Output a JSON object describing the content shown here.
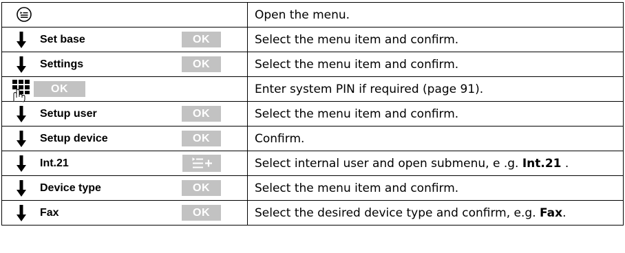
{
  "rows": [
    {
      "type": "menu",
      "icon": "menu-key-icon",
      "desc": "Open the menu."
    },
    {
      "type": "nav",
      "item": "Set base",
      "action": "OK",
      "desc": "Select the menu item and confirm."
    },
    {
      "type": "nav",
      "item": "Settings",
      "action": "OK",
      "desc": "Select the menu item and confirm."
    },
    {
      "type": "pin",
      "icon": "keypad-icon",
      "action": "OK",
      "desc_pre": "Enter system PIN if required (page 91)."
    },
    {
      "type": "nav",
      "item": "Setup user",
      "action": "OK",
      "desc": "Select the menu item and confirm."
    },
    {
      "type": "nav",
      "item": "Setup device",
      "action": "OK",
      "desc": "Confirm."
    },
    {
      "type": "submenu",
      "item": "Int.21",
      "icon": "submenu-icon",
      "desc_pre": "Select internal user and open submenu, e .g. ",
      "desc_bold": "Int.21",
      "desc_post": " ."
    },
    {
      "type": "nav",
      "item": "Device type",
      "action": "OK",
      "desc": "Select the menu item and confirm."
    },
    {
      "type": "nav",
      "item": "Fax",
      "action": "OK",
      "desc_pre": "Select the desired device type and confirm, e.g. ",
      "desc_bold": "Fax",
      "desc_post": "."
    }
  ],
  "colors": {
    "ok_bg": "#c2c2c2",
    "ok_text": "#ffffff",
    "border": "#000000"
  }
}
